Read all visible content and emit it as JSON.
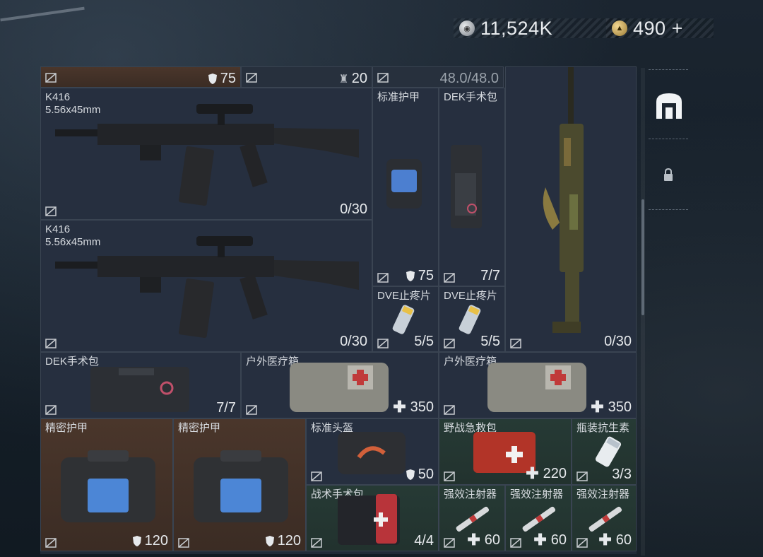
{
  "currency": {
    "silver_icon": "silver-coin-icon",
    "silver_value": "11,524K",
    "gold_icon": "gold-coin-icon",
    "gold_value": "490",
    "gold_plus": "+"
  },
  "top_row": {
    "armor_value": "75",
    "durability_value": "20",
    "weight_value": "48.0/48.0"
  },
  "items": {
    "k416_a": {
      "name": "K416",
      "caliber": "5.56x45mm",
      "ammo": "0/30"
    },
    "k416_b": {
      "name": "K416",
      "caliber": "5.56x45mm",
      "ammo": "0/30"
    },
    "armor_std": {
      "name": "标准护甲",
      "value": "75"
    },
    "dek_kit_a": {
      "name": "DEK手术包",
      "value": "7/7"
    },
    "dve_a": {
      "name": "DVE止疼片",
      "value": "5/5"
    },
    "dve_b": {
      "name": "DVE止疼片",
      "value": "5/5"
    },
    "ak_rifle": {
      "ammo": "0/30"
    },
    "dek_kit_b": {
      "name": "DEK手术包",
      "value": "7/7"
    },
    "outdoor_med_a": {
      "name": "户外医疗箱",
      "value": "350"
    },
    "outdoor_med_b": {
      "name": "户外医疗箱",
      "value": "350"
    },
    "precision_armor_a": {
      "name": "精密护甲",
      "value": "120"
    },
    "precision_armor_b": {
      "name": "精密护甲",
      "value": "120"
    },
    "std_helmet": {
      "name": "标准头盔",
      "value": "50"
    },
    "field_aid": {
      "name": "野战急救包",
      "value": "220"
    },
    "antibiotic": {
      "name": "瓶装抗生素",
      "value": "3/3"
    },
    "tactical_kit": {
      "name": "战术手术包",
      "value": "4/4"
    },
    "injector_a": {
      "name": "强效注射器",
      "value": "60"
    },
    "injector_b": {
      "name": "强效注射器",
      "value": "60"
    },
    "injector_c": {
      "name": "强效注射器",
      "value": "60"
    }
  },
  "colors": {
    "brown": "#4a362b",
    "green": "#263a35",
    "blue": "#262f3f",
    "red": "#3a2f2d"
  }
}
